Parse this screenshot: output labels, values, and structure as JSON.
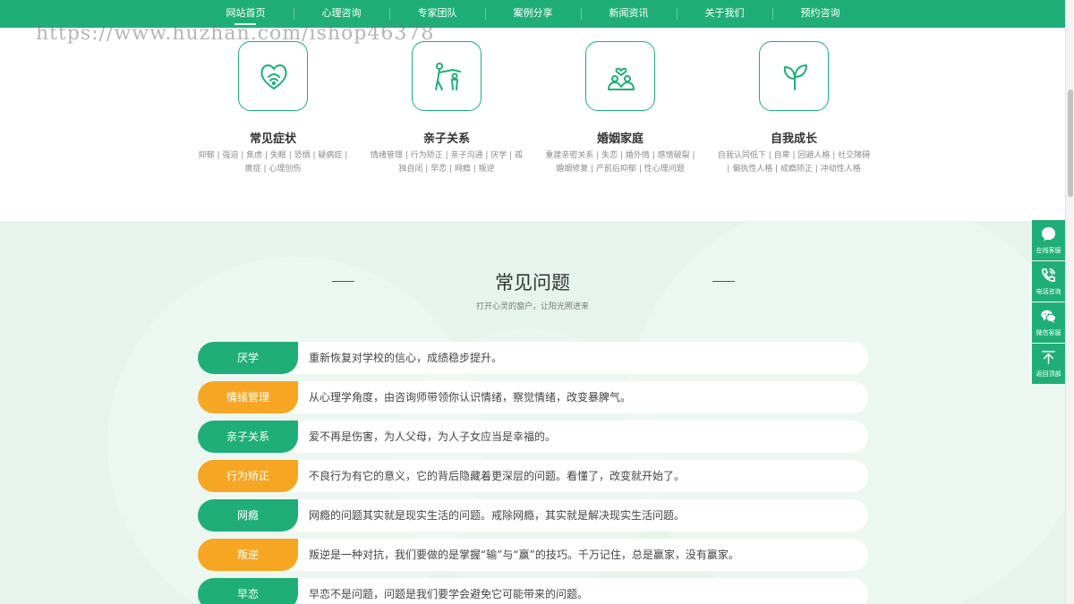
{
  "nav": {
    "items": [
      {
        "label": "网站首页",
        "active": true
      },
      {
        "label": "心理咨询"
      },
      {
        "label": "专家团队"
      },
      {
        "label": "案例分享"
      },
      {
        "label": "新闻资讯"
      },
      {
        "label": "关于我们"
      },
      {
        "label": "预约咨询"
      }
    ]
  },
  "watermark": "https://www.huzhan.com/ishop46378",
  "categories": [
    {
      "title": "常见症状",
      "icon": "heart-icon",
      "tags_line1": "抑郁 | 强迫 | 焦虑 | 失眠 | 恐惧 | 疑病症 |",
      "tags_line2": "癔症 | 心理创伤"
    },
    {
      "title": "亲子关系",
      "icon": "parent-child-icon",
      "tags_line1": "情绪管理 | 行为矫正 | 亲子沟通 | 厌学 | 孤",
      "tags_line2": "独自闭 | 早恋 | 网瘾 | 叛逆"
    },
    {
      "title": "婚姻家庭",
      "icon": "couple-icon",
      "tags_line1": "重建亲密关系 | 失恋 | 婚外情 | 感情破裂 |",
      "tags_line2": "婚姻修复 | 产前后抑郁 | 性心理问题"
    },
    {
      "title": "自我成长",
      "icon": "sprout-icon",
      "tags_line1": "自我认同低下 | 自卑 | 回避人格 | 社交障碍",
      "tags_line2": "| 偏执性人格 | 成瘾矫正 | 冲动性人格"
    }
  ],
  "faq": {
    "title": "常见问题",
    "subtitle": "打开心灵的窗户，让阳光照进来",
    "items": [
      {
        "tag": "厌学",
        "color": "green",
        "text": "重新恢复对学校的信心，成绩稳步提升。"
      },
      {
        "tag": "情绪管理",
        "color": "orange",
        "text": "从心理学角度，由咨询师带领你认识情绪，察觉情绪，改变暴脾气。"
      },
      {
        "tag": "亲子关系",
        "color": "green",
        "text": "爱不再是伤害，为人父母，为人子女应当是幸福的。"
      },
      {
        "tag": "行为矫正",
        "color": "orange",
        "text": "不良行为有它的意义，它的背后隐藏着更深层的问题。看懂了，改变就开始了。"
      },
      {
        "tag": "网瘾",
        "color": "green",
        "text": "网瘾的问题其实就是现实生活的问题。戒除网瘾，其实就是解决现实生活问题。"
      },
      {
        "tag": "叛逆",
        "color": "orange",
        "text": "叛逆是一种对抗，我们要做的是掌握“输”与“赢”的技巧。千万记住，总是赢家，没有赢家。"
      },
      {
        "tag": "早恋",
        "color": "green",
        "text": "早恋不是问题，问题是我们要学会避免它可能带来的问题。"
      }
    ]
  },
  "float_bar": [
    {
      "label": "在线客服",
      "icon": "chat-bubble-icon"
    },
    {
      "label": "电话咨询",
      "icon": "phone-icon"
    },
    {
      "label": "微信客服",
      "icon": "wechat-icon"
    },
    {
      "label": "返回顶部",
      "icon": "back-to-top-icon"
    }
  ],
  "colors": {
    "brand_green": "#1fae78",
    "accent_orange": "#f6a623",
    "faq_bg": "#e6f4ec"
  }
}
